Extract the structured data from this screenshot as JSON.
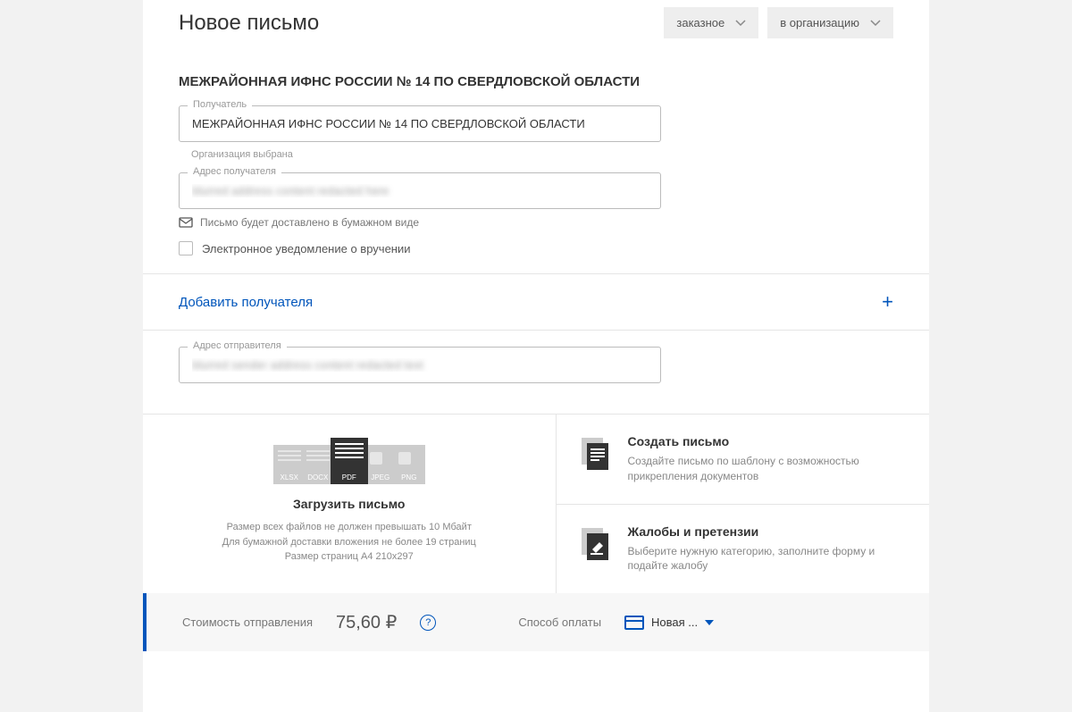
{
  "header": {
    "title": "Новое письмо",
    "type_dropdown": "заказное",
    "dest_dropdown": "в организацию"
  },
  "recipient": {
    "title": "МЕЖРАЙОННАЯ ИФНС РОССИИ № 14 ПО СВЕРДЛОВСКОЙ ОБЛАСТИ",
    "field_label": "Получатель",
    "field_value": "МЕЖРАЙОННАЯ ИФНС РОССИИ № 14 ПО СВЕРДЛОВСКОЙ ОБЛАСТИ",
    "hint": "Организация выбрана",
    "address_label": "Адрес получателя",
    "delivery_info": "Письмо будет доставлено в бумажном виде",
    "checkbox_label": "Электронное уведомление о вручении"
  },
  "add_recipient": "Добавить получателя",
  "sender": {
    "address_label": "Адрес отправителя"
  },
  "upload": {
    "title": "Загрузить письмо",
    "line1": "Размер всех файлов не должен превышать 10 Мбайт",
    "line2": "Для бумажной доставки вложения не более 19 страниц",
    "line3": "Размер страниц A4 210x297",
    "fmt1": "XLSX",
    "fmt2": "DOCX",
    "fmt3": "PDF",
    "fmt4": "JPEG",
    "fmt5": "PNG"
  },
  "create": {
    "title": "Создать письмо",
    "desc": "Создайте письмо по шаблону с возможностью прикрепления документов"
  },
  "complaint": {
    "title": "Жалобы и претензии",
    "desc": "Выберите нужную категорию, заполните форму и подайте жалобу"
  },
  "footer": {
    "cost_label": "Стоимость отправления",
    "price": "75,60 ₽",
    "pay_label": "Способ оплаты",
    "pay_value": "Новая ..."
  }
}
